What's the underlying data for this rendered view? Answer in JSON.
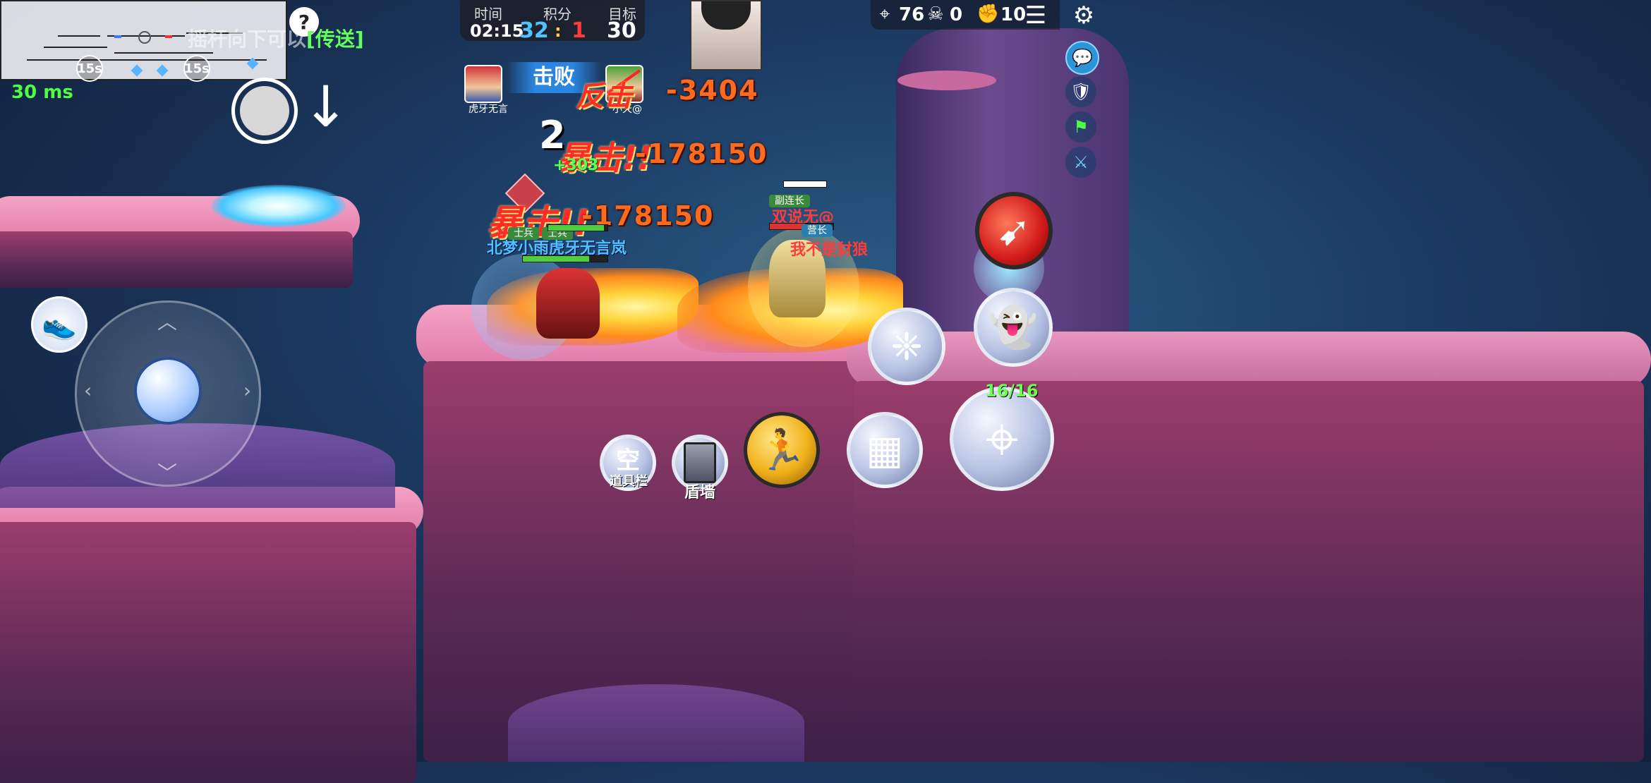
{
  "minimap": {
    "timer_left": "15s",
    "timer_right": "15s"
  },
  "network": {
    "ping": "30 ms"
  },
  "hint": {
    "question": "?",
    "prefix": "摇杆向下可以",
    "highlight": "[传送]"
  },
  "scoreboard": {
    "time_label": "时间",
    "score_label": "积分",
    "target_label": "目标",
    "time": "02:15",
    "blue_score": "32",
    "separator": ":",
    "red_score": "1",
    "target": "30"
  },
  "stats": {
    "kills_icon": "crosshair-icon",
    "kills": "76",
    "deaths_icon": "skull-icon",
    "deaths": "0",
    "assists_icon": "fist-icon",
    "assists": "10"
  },
  "kill_feed": {
    "action": "击败",
    "killer_name": "虎牙无言",
    "victim_name": "小天@"
  },
  "damage_numbers": {
    "counter_text": "反击",
    "counter_value": "-3404",
    "combo": "2",
    "crit_text_1": "暴击!!",
    "crit_value_1": "-178150",
    "heal_value": "+303",
    "crit_text_2": "暴击!!",
    "crit_value_2": "-178150"
  },
  "players": {
    "ally_rank_1": "士兵",
    "ally_rank_2": "士兵",
    "ally_name": "北梦小雨虎牙无言岚",
    "enemy_rank_1": "副连长",
    "enemy_name_1": "双说无@",
    "enemy_rank_2": "营长",
    "enemy_name_2": "我不是豺狼"
  },
  "controls": {
    "item_slot_glyph": "空",
    "item_slot_label": "道具栏",
    "shield_wall_label": "盾墙",
    "ammo": "16/16"
  },
  "colors": {
    "blue_team": "#4fc3ff",
    "red_team": "#ff3b3b",
    "ping_green": "#4cff44",
    "damage_orange": "#ff6b1e"
  }
}
